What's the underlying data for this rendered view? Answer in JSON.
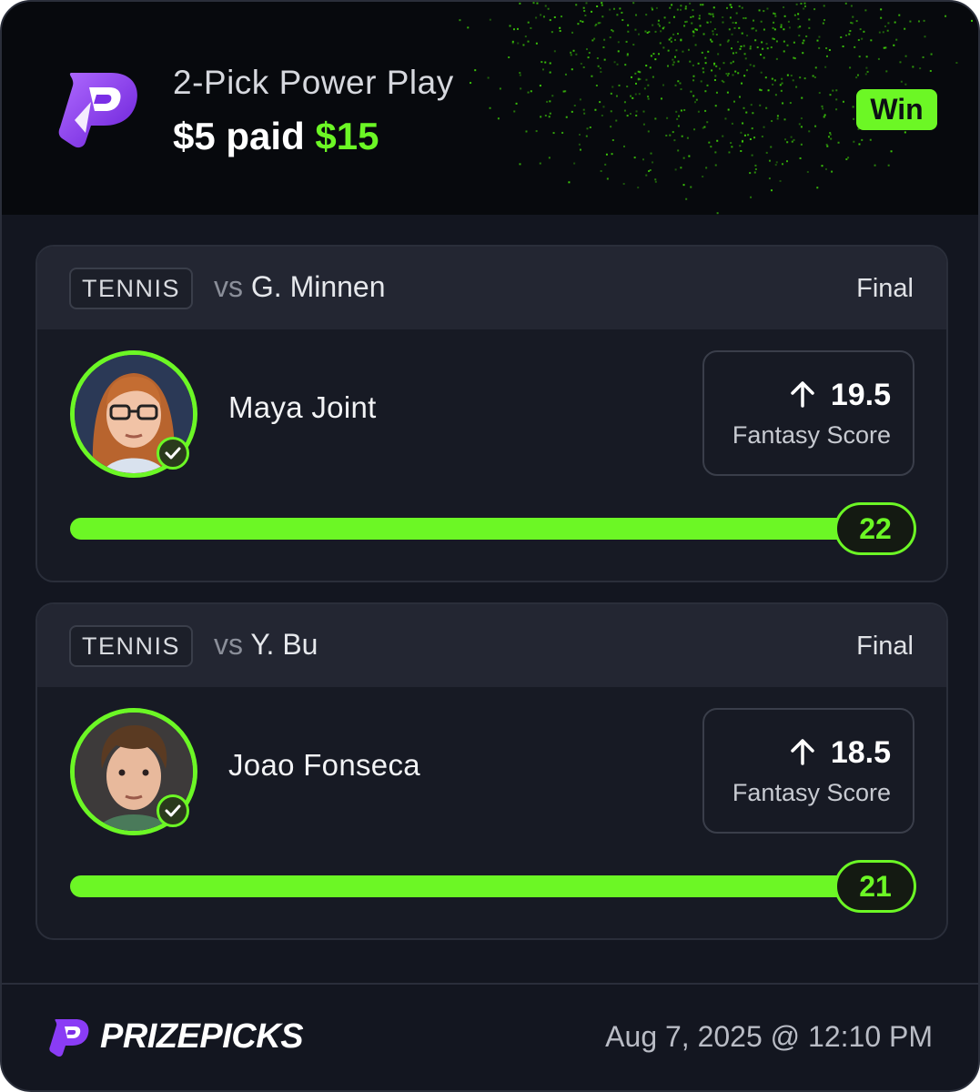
{
  "header": {
    "play_type": "2-Pick Power Play",
    "entry_amount": "$5",
    "paid_word": "paid",
    "payout_amount": "$15",
    "result_badge": "Win",
    "logo_icon": "prizepicks-p-logo"
  },
  "picks": [
    {
      "sport": "TENNIS",
      "vs_prefix": "vs",
      "opponent": "G. Minnen",
      "status": "Final",
      "player_name": "Maya Joint",
      "direction_icon": "arrow-up-icon",
      "line": "19.5",
      "stat": "Fantasy Score",
      "result": "22",
      "progress_fraction": 1.0,
      "hit": true
    },
    {
      "sport": "TENNIS",
      "vs_prefix": "vs",
      "opponent": "Y. Bu",
      "status": "Final",
      "player_name": "Joao Fonseca",
      "direction_icon": "arrow-up-icon",
      "line": "18.5",
      "stat": "Fantasy Score",
      "result": "21",
      "progress_fraction": 1.0,
      "hit": true
    }
  ],
  "footer": {
    "brand": "PRIZEPICKS",
    "timestamp": "Aug 7, 2025 @ 12:10 PM"
  },
  "colors": {
    "accent_green": "#6cf725",
    "brand_purple": "#8a3cf5",
    "background": "#131620"
  }
}
